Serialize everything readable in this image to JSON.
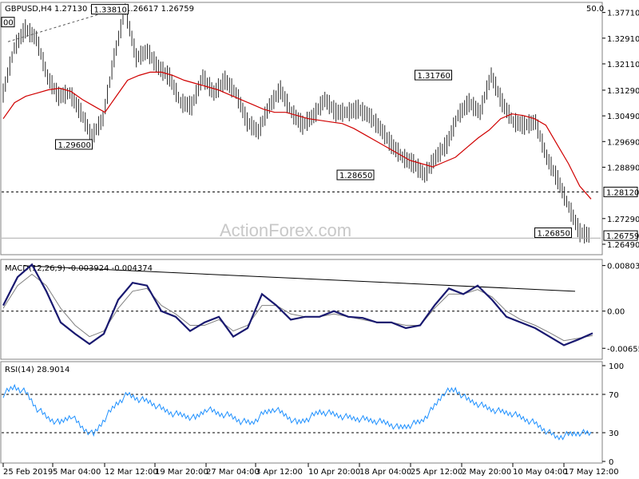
{
  "chart_data": [
    {
      "type": "candlestick",
      "symbol_label": "GBPUSD,H4",
      "ohlc_label": "1.27130 1.27158 1.26617 1.26759",
      "top_right_label": "50.0",
      "watermark": "ActionForex.com",
      "ylim": [
        1.2624,
        1.3395
      ],
      "y_ticks": [
        "1.37710",
        "1.32910",
        "1.32110",
        "1.31290",
        "1.30490",
        "1.29690",
        "1.28890",
        "1.27290",
        "1.26490"
      ],
      "y_ticks_values": [
        1.3371,
        1.3291,
        1.3211,
        1.3129,
        1.3049,
        1.2969,
        1.2889,
        1.2729,
        1.2649
      ],
      "current_price": "1.26759",
      "level_line": {
        "value": 1.2812,
        "label": "1.28120"
      },
      "ma": {
        "name": "MA 55",
        "color": "#d00000"
      },
      "price_points": [
        1.312,
        1.326,
        1.332,
        1.329,
        1.317,
        1.311,
        1.312,
        1.306,
        1.2985,
        1.304,
        1.323,
        1.3381,
        1.323,
        1.325,
        1.32,
        1.317,
        1.309,
        1.308,
        1.317,
        1.312,
        1.316,
        1.312,
        1.303,
        1.3,
        1.308,
        1.313,
        1.306,
        1.302,
        1.305,
        1.31,
        1.306,
        1.306,
        1.307,
        1.305,
        1.301,
        1.296,
        1.292,
        1.29,
        1.2865,
        1.292,
        1.296,
        1.305,
        1.309,
        1.306,
        1.3176,
        1.309,
        1.303,
        1.302,
        1.303,
        1.292,
        1.285,
        1.2765,
        1.2685,
        1.2676
      ],
      "ma_points": [
        1.304,
        1.309,
        1.311,
        1.312,
        1.313,
        1.3135,
        1.3125,
        1.31,
        1.308,
        1.306,
        1.311,
        1.316,
        1.3175,
        1.3185,
        1.3185,
        1.3175,
        1.316,
        1.315,
        1.314,
        1.313,
        1.3115,
        1.31,
        1.3085,
        1.307,
        1.306,
        1.306,
        1.305,
        1.304,
        1.3035,
        1.303,
        1.3025,
        1.301,
        1.299,
        1.297,
        1.295,
        1.293,
        1.291,
        1.29,
        1.289,
        1.2905,
        1.292,
        1.295,
        1.298,
        1.3005,
        1.304,
        1.3055,
        1.305,
        1.304,
        1.302,
        1.296,
        1.29,
        1.283,
        1.279
      ],
      "annotations": [
        {
          "label": "1.33810",
          "x": 0.15,
          "value": 1.3381
        },
        {
          "label": "1.29600",
          "x": 0.09,
          "value": 1.296
        },
        {
          "label": "1.28650",
          "x": 0.56,
          "value": 1.2865
        },
        {
          "label": "1.31760",
          "x": 0.69,
          "value": 1.3176
        },
        {
          "label": "1.26850",
          "x": 0.89,
          "value": 1.2685
        }
      ],
      "left_clipped_label": "00"
    },
    {
      "type": "line",
      "name": "MACD",
      "label": "MACD(12,26,9) -0.003924 -0.004374",
      "ylim": [
        -0.0082,
        0.0084
      ],
      "y_ticks": [
        "0.008031",
        "0.00",
        "-0.00655"
      ],
      "y_ticks_values": [
        0.00803,
        0.0,
        -0.00655
      ],
      "macd_points": [
        0.001,
        0.006,
        0.0082,
        0.0035,
        -0.002,
        -0.004,
        -0.0058,
        -0.004,
        0.002,
        0.005,
        0.0045,
        0.0,
        -0.001,
        -0.0035,
        -0.002,
        -0.001,
        -0.0045,
        -0.003,
        0.003,
        0.001,
        -0.0015,
        -0.001,
        -0.001,
        0.0,
        -0.001,
        -0.0012,
        -0.002,
        -0.002,
        -0.003,
        -0.0025,
        0.001,
        0.004,
        0.003,
        0.0045,
        0.002,
        -0.001,
        -0.002,
        -0.003,
        -0.0045,
        -0.006,
        -0.005,
        -0.0039
      ],
      "signal_points": [
        0.0005,
        0.0045,
        0.0065,
        0.0045,
        0.0005,
        -0.0025,
        -0.0045,
        -0.0035,
        0.0005,
        0.0035,
        0.004,
        0.001,
        -0.0005,
        -0.0025,
        -0.0025,
        -0.0015,
        -0.0035,
        -0.0025,
        0.001,
        0.001,
        -0.0005,
        -0.001,
        -0.001,
        -0.0005,
        -0.001,
        -0.0015,
        -0.002,
        -0.002,
        -0.0025,
        -0.0025,
        0.0005,
        0.003,
        0.003,
        0.0038,
        0.0025,
        0.0,
        -0.0015,
        -0.0025,
        -0.0038,
        -0.0052,
        -0.0048,
        -0.0043
      ],
      "trendline": {
        "from": 0.008,
        "to": 0.0035
      },
      "colors": {
        "macd": "#191970",
        "signal": "#808080"
      }
    },
    {
      "type": "line",
      "name": "RSI",
      "label": "RSI(14) 28.9014",
      "ylim": [
        0,
        100
      ],
      "y_ticks": [
        "100",
        "70",
        "30",
        "0"
      ],
      "y_ticks_values": [
        100,
        70,
        30,
        0
      ],
      "rsi_points": [
        70,
        78,
        72,
        55,
        45,
        40,
        48,
        35,
        28,
        45,
        60,
        70,
        65,
        62,
        55,
        50,
        48,
        45,
        55,
        50,
        48,
        42,
        40,
        50,
        55,
        48,
        40,
        45,
        52,
        50,
        47,
        45,
        44,
        42,
        40,
        35,
        38,
        42,
        55,
        72,
        75,
        65,
        60,
        55,
        52,
        50,
        45,
        40,
        32,
        25,
        28,
        30,
        29
      ],
      "color": "#1e90ff"
    }
  ],
  "x_axis": {
    "labels": [
      "25 Feb 2019",
      "5 Mar 04:00",
      "12 Mar 12:00",
      "19 Mar 20:00",
      "27 Mar 04:00",
      "3 Apr 12:00",
      "10 Apr 20:00",
      "18 Apr 04:00",
      "25 Apr 12:00",
      "2 May 20:00",
      "10 May 04:00",
      "17 May 12:00"
    ]
  }
}
